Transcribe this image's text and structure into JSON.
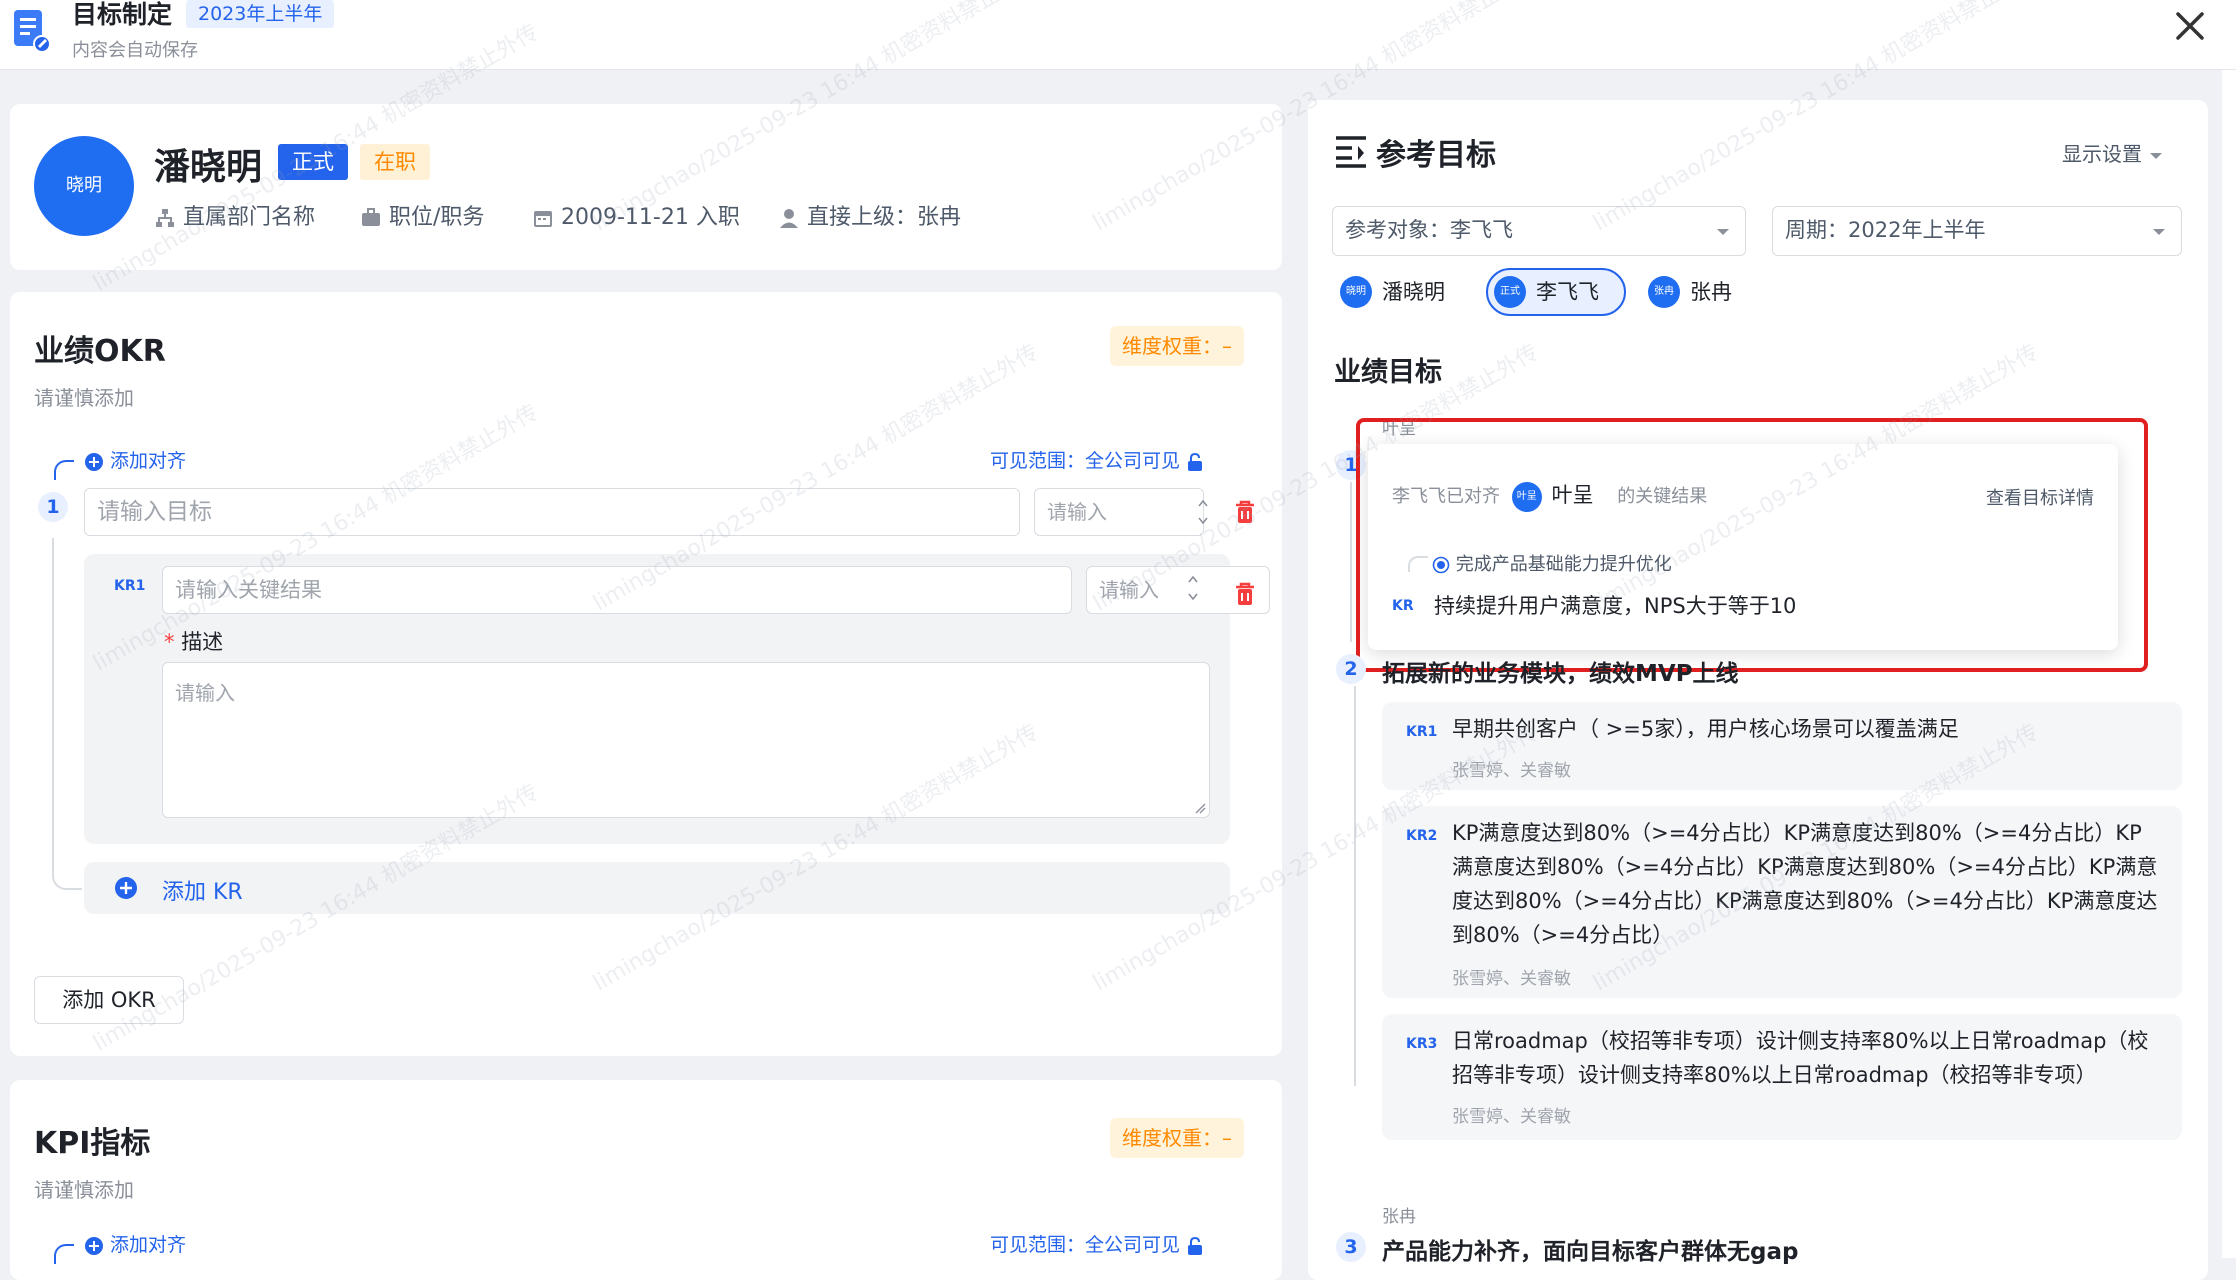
{
  "header": {
    "title": "目标制定",
    "period_tag": "2023年上半年",
    "autosave_text": "内容会自动保存"
  },
  "employee": {
    "avatar_text": "晓明",
    "name": "潘晓明",
    "status_formal": "正式",
    "status_active": "在职",
    "department": "直属部门名称",
    "position": "职位/职务",
    "join_date": "2009-11-21 入职",
    "manager": "直接上级：张冉"
  },
  "okr_section": {
    "title": "业绩OKR",
    "subtitle": "请谨慎添加",
    "weight_label": "维度权重：–",
    "add_align": "添加对齐",
    "visibility": "可见范围：全公司可见",
    "objective_number": "1",
    "objective_placeholder": "请输入目标",
    "weight_placeholder": "请输入",
    "kr_label": "KR1",
    "kr_placeholder": "请输入关键结果",
    "kr_weight_placeholder": "请输入",
    "desc_label": "描述",
    "desc_placeholder": "请输入",
    "add_kr": "添加 KR",
    "add_okr": "添加 OKR"
  },
  "kpi_section": {
    "title": "KPI指标",
    "subtitle": "请谨慎添加",
    "weight_label": "维度权重：–",
    "add_align": "添加对齐",
    "visibility": "可见范围：全公司可见"
  },
  "reference": {
    "title": "参考目标",
    "display_settings": "显示设置",
    "ref_object": "参考对象：李飞飞",
    "period": "周期：2022年上半年",
    "people": [
      {
        "avatar": "晓明",
        "name": "潘晓明"
      },
      {
        "avatar": "正式",
        "name": "李飞飞"
      },
      {
        "avatar": "张冉",
        "name": "张冉"
      }
    ],
    "section_title": "业绩目标",
    "obj1_owner": "叶呈",
    "obj1_number": "1",
    "popover": {
      "prefix": "李飞飞已对齐",
      "avatar": "叶呈",
      "name": "叶呈",
      "suffix": "的关键结果",
      "view_detail": "查看目标详情",
      "objective": "完成产品基础能力提升优化",
      "kr_label": "KR",
      "kr_text": "持续提升用户满意度，NPS大于等于10"
    },
    "obj2_number": "2",
    "obj2_title": "拓展新的业务模块，绩效MVP上线",
    "krs": [
      {
        "label": "KR1",
        "lines": [
          "早期共创客户（ >=5家），用户核心场景可以覆盖满足"
        ],
        "names": "张雪婷、关睿敏"
      },
      {
        "label": "KR2",
        "lines": [
          "KP满意度达到80%（>=4分占比）KP满意度达到80%（>=4分占比）KP",
          "满意度达到80%（>=4分占比）KP满意度达到80%（>=4分占比）KP满意",
          "度达到80%（>=4分占比）KP满意度达到80%（>=4分占比）KP满意度达",
          "到80%（>=4分占比）"
        ],
        "names": "张雪婷、关睿敏"
      },
      {
        "label": "KR3",
        "lines": [
          "日常roadmap（校招等非专项）设计侧支持率80%以上日常roadmap（校",
          "招等非专项）设计侧支持率80%以上日常roadmap（校招等非专项）"
        ],
        "names": "张雪婷、关睿敏"
      }
    ],
    "obj3_owner": "张冉",
    "obj3_number": "3",
    "obj3_title": "产品能力补齐，面向目标客户群体无gap"
  },
  "watermark": "limingchao/2025-09-23 16:44  机密资料禁止外传",
  "colors": {
    "primary": "#2463eb",
    "orange": "#ff8a00",
    "danger": "#f53f3f",
    "highlight": "#e02020"
  }
}
